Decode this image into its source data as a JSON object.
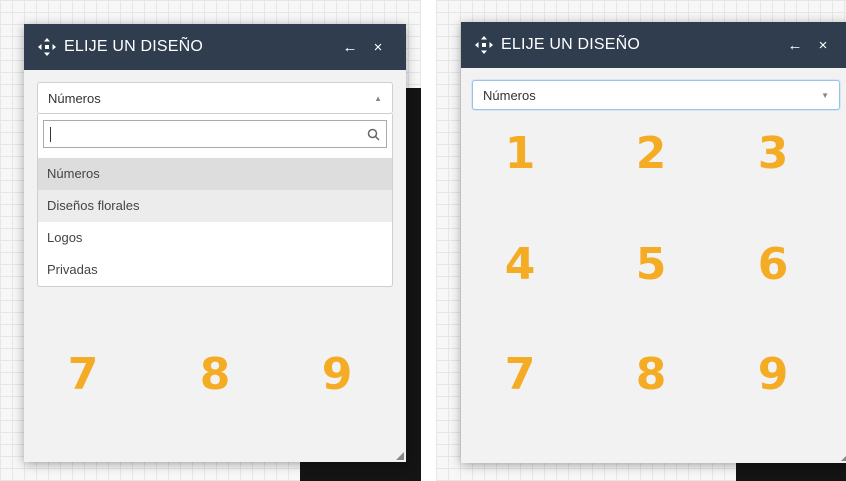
{
  "colors": {
    "titlebar": "#2f3d4f",
    "accent_number": "#f5ac25",
    "grid_bg": "#f7f7f7"
  },
  "left_panel": {
    "title": "ELIJE UN DISEÑO",
    "move_icon": "move-arrows-icon",
    "back_icon": "arrow-left-icon",
    "close_icon": "close-icon",
    "back_glyph": "←",
    "close_glyph": "×",
    "select_value": "Números",
    "dropdown_open": true,
    "search_value": "",
    "options": [
      "Números",
      "Diseños florales",
      "Logos",
      "Privadas"
    ],
    "selected_option": "Números",
    "numbers_visible": [
      "7",
      "8",
      "9"
    ]
  },
  "right_panel": {
    "title": "ELIJE UN DISEÑO",
    "move_icon": "move-arrows-icon",
    "back_icon": "arrow-left-icon",
    "close_icon": "close-icon",
    "back_glyph": "←",
    "close_glyph": "×",
    "select_value": "Números",
    "dropdown_open": false,
    "numbers": [
      "1",
      "2",
      "3",
      "4",
      "5",
      "6",
      "7",
      "8",
      "9"
    ]
  }
}
